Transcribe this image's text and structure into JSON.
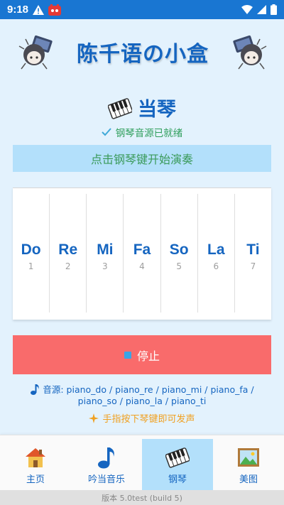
{
  "status_bar": {
    "time": "9:18",
    "icons": [
      "warning-icon",
      "notification-app-icon",
      "wifi-icon",
      "signal-icon",
      "battery-icon"
    ]
  },
  "header": {
    "title": "陈千语の小盒"
  },
  "section": {
    "title": "当琴",
    "ready_text": "钢琴音源已就绪"
  },
  "hint": "点击钢琴键开始演奏",
  "keys": [
    {
      "name": "Do",
      "num": "1"
    },
    {
      "name": "Re",
      "num": "2"
    },
    {
      "name": "Mi",
      "num": "3"
    },
    {
      "name": "Fa",
      "num": "4"
    },
    {
      "name": "So",
      "num": "5"
    },
    {
      "name": "La",
      "num": "6"
    },
    {
      "name": "Ti",
      "num": "7"
    }
  ],
  "stop_label": "停止",
  "source_text": "音源: piano_do / piano_re / piano_mi / piano_fa / piano_so / piano_la / piano_ti",
  "tip_text": "手指按下琴键即可发声",
  "nav": [
    {
      "label": "主页",
      "icon": "house-icon"
    },
    {
      "label": "吟当音乐",
      "icon": "music-note-icon"
    },
    {
      "label": "钢琴",
      "icon": "piano-icon",
      "active": true
    },
    {
      "label": "美图",
      "icon": "framed-picture-icon"
    }
  ],
  "version": "版本 5.0test (build 5)",
  "colors": {
    "status_bar": "#1976d2",
    "background": "#e3f2fd",
    "accent": "#1565c0",
    "stop": "#f96b6b",
    "active_tab": "#b3e0fb"
  }
}
